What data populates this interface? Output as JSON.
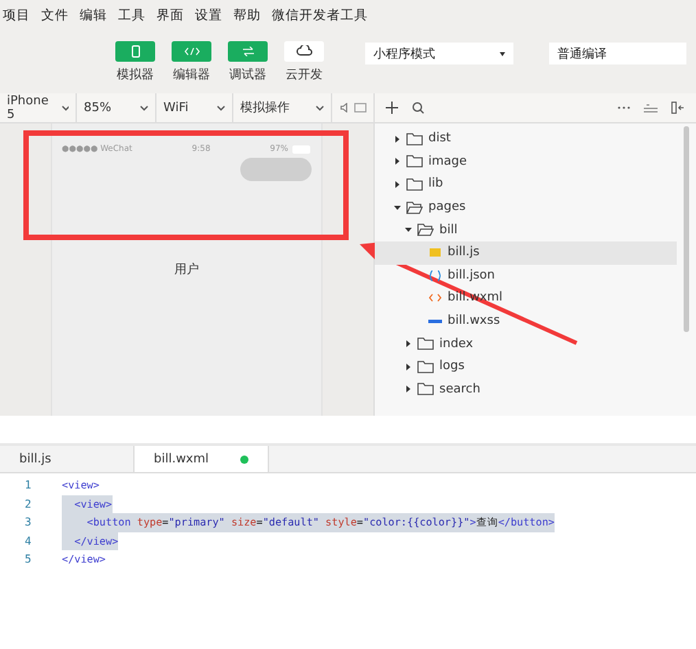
{
  "menu": [
    "项目",
    "文件",
    "编辑",
    "工具",
    "界面",
    "设置",
    "帮助",
    "微信开发者工具"
  ],
  "toolbar": {
    "buttons": [
      {
        "label": "模拟器",
        "kind": "phone",
        "on": true
      },
      {
        "label": "编辑器",
        "kind": "code",
        "on": true
      },
      {
        "label": "调试器",
        "kind": "debug",
        "on": true
      },
      {
        "label": "云开发",
        "kind": "cloud",
        "on": false
      }
    ],
    "mode_select": "小程序模式",
    "compile_select": "普通编译"
  },
  "device_bar": [
    "iPhone 5",
    "85%",
    "WiFi",
    "模拟操作"
  ],
  "simulator": {
    "carrier": "●●●●● WeChat",
    "time": "9:58",
    "battery": "97%",
    "content": "用户"
  },
  "tree": [
    {
      "name": "dist",
      "kind": "folder",
      "expanded": false,
      "selected": false
    },
    {
      "name": "image",
      "kind": "folder",
      "expanded": false,
      "selected": false
    },
    {
      "name": "lib",
      "kind": "folder",
      "expanded": false,
      "selected": false
    },
    {
      "name": "pages",
      "kind": "folder",
      "expanded": true,
      "selected": false,
      "children": [
        {
          "name": "bill",
          "kind": "folder",
          "expanded": true,
          "selected": false,
          "children": [
            {
              "name": "bill.js",
              "kind": "js",
              "selected": true
            },
            {
              "name": "bill.json",
              "kind": "json",
              "selected": false
            },
            {
              "name": "bill.wxml",
              "kind": "wxml",
              "selected": false
            },
            {
              "name": "bill.wxss",
              "kind": "wxss",
              "selected": false
            }
          ]
        },
        {
          "name": "index",
          "kind": "folder",
          "expanded": false,
          "selected": false
        },
        {
          "name": "logs",
          "kind": "folder",
          "expanded": false,
          "selected": false
        },
        {
          "name": "search",
          "kind": "folder",
          "expanded": false,
          "selected": false
        }
      ]
    }
  ],
  "editor": {
    "tabs": [
      {
        "label": "bill.js",
        "selected": false,
        "modified": false
      },
      {
        "label": "bill.wxml",
        "selected": true,
        "modified": true
      }
    ],
    "lines": [
      {
        "number": "1",
        "highlighted": false,
        "tokens": [
          {
            "kind": "tag",
            "text": "<view>"
          }
        ]
      },
      {
        "number": "2",
        "highlighted": true,
        "tokens": [
          {
            "kind": "tag",
            "text": "  <view>"
          }
        ]
      },
      {
        "number": "3",
        "highlighted": true,
        "tokens": [
          {
            "kind": "tag",
            "text": "    <button"
          },
          {
            "kind": "attr",
            "text": " type"
          },
          {
            "kind": "plain",
            "text": "="
          },
          {
            "kind": "string",
            "text": "\"primary\""
          },
          {
            "kind": "attr",
            "text": " size"
          },
          {
            "kind": "plain",
            "text": "="
          },
          {
            "kind": "string",
            "text": "\"default\""
          },
          {
            "kind": "attr",
            "text": " style"
          },
          {
            "kind": "plain",
            "text": "="
          },
          {
            "kind": "string",
            "text": "\"color:{{color}}\""
          },
          {
            "kind": "tag",
            "text": ">"
          },
          {
            "kind": "plain",
            "text": "查询"
          },
          {
            "kind": "tag",
            "text": "</button>"
          }
        ]
      },
      {
        "number": "4",
        "highlighted": true,
        "tokens": [
          {
            "kind": "tag",
            "text": "  </view>"
          }
        ]
      },
      {
        "number": "5",
        "highlighted": false,
        "tokens": [
          {
            "kind": "tag",
            "text": "</view>"
          }
        ]
      }
    ]
  }
}
